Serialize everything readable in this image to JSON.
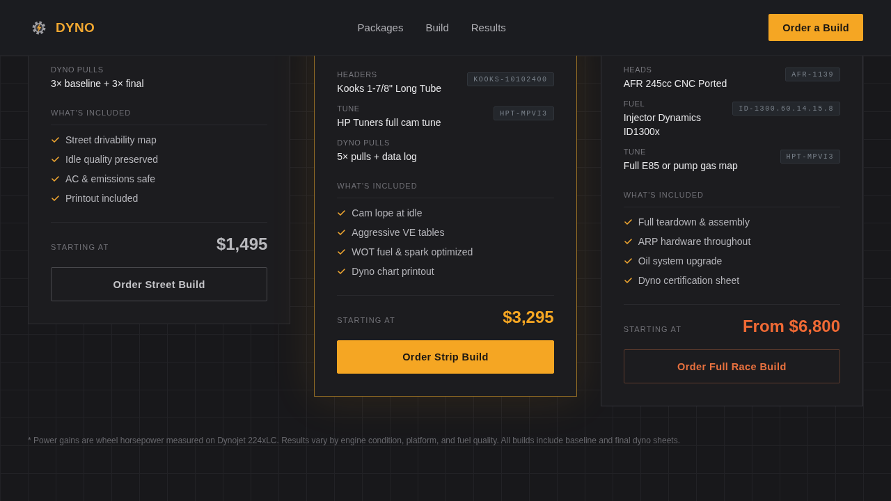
{
  "header": {
    "brand": "DYNO",
    "nav": [
      {
        "label": "Packages"
      },
      {
        "label": "Build"
      },
      {
        "label": "Results"
      }
    ],
    "cta": "Order a Build"
  },
  "packages": [
    {
      "kind": "standard",
      "specs": [
        {
          "label": "DYNO PULLS",
          "value": "3× baseline + 3× final"
        }
      ],
      "included_title": "WHAT'S INCLUDED",
      "features": [
        "Street drivability map",
        "Idle quality preserved",
        "AC & emissions safe",
        "Printout included"
      ],
      "price_label": "STARTING AT",
      "price": "$1,495",
      "button": "Order Street Build"
    },
    {
      "kind": "featured",
      "specs": [
        {
          "label": "HEADERS",
          "value": "Kooks 1-7/8\" Long Tube",
          "code": "KOOKS-10102400"
        },
        {
          "label": "TUNE",
          "value": "HP Tuners full cam tune",
          "code": "HPT-MPVI3"
        },
        {
          "label": "DYNO PULLS",
          "value": "5× pulls + data log"
        }
      ],
      "included_title": "WHAT'S INCLUDED",
      "features": [
        "Cam lope at idle",
        "Aggressive VE tables",
        "WOT fuel & spark optimized",
        "Dyno chart printout"
      ],
      "price_label": "STARTING AT",
      "price": "$3,295",
      "button": "Order Strip Build"
    },
    {
      "kind": "race",
      "specs": [
        {
          "label": "HEADS",
          "value": "AFR 245cc CNC Ported",
          "code": "AFR-1139"
        },
        {
          "label": "FUEL",
          "value": "Injector Dynamics ID1300x",
          "code": "ID-1300.60.14.15.8"
        },
        {
          "label": "TUNE",
          "value": "Full E85 or pump gas map",
          "code": "HPT-MPVI3"
        }
      ],
      "included_title": "WHAT'S INCLUDED",
      "features": [
        "Full teardown & assembly",
        "ARP hardware throughout",
        "Oil system upgrade",
        "Dyno certification sheet"
      ],
      "price_label": "STARTING AT",
      "price": "From $6,800",
      "button": "Order Full Race Build"
    }
  ],
  "footnote": "* Power gains are wheel horsepower measured on Dynojet 224xLC. Results vary by engine condition, platform, and fuel quality. All builds include baseline and final dyno sheets."
}
